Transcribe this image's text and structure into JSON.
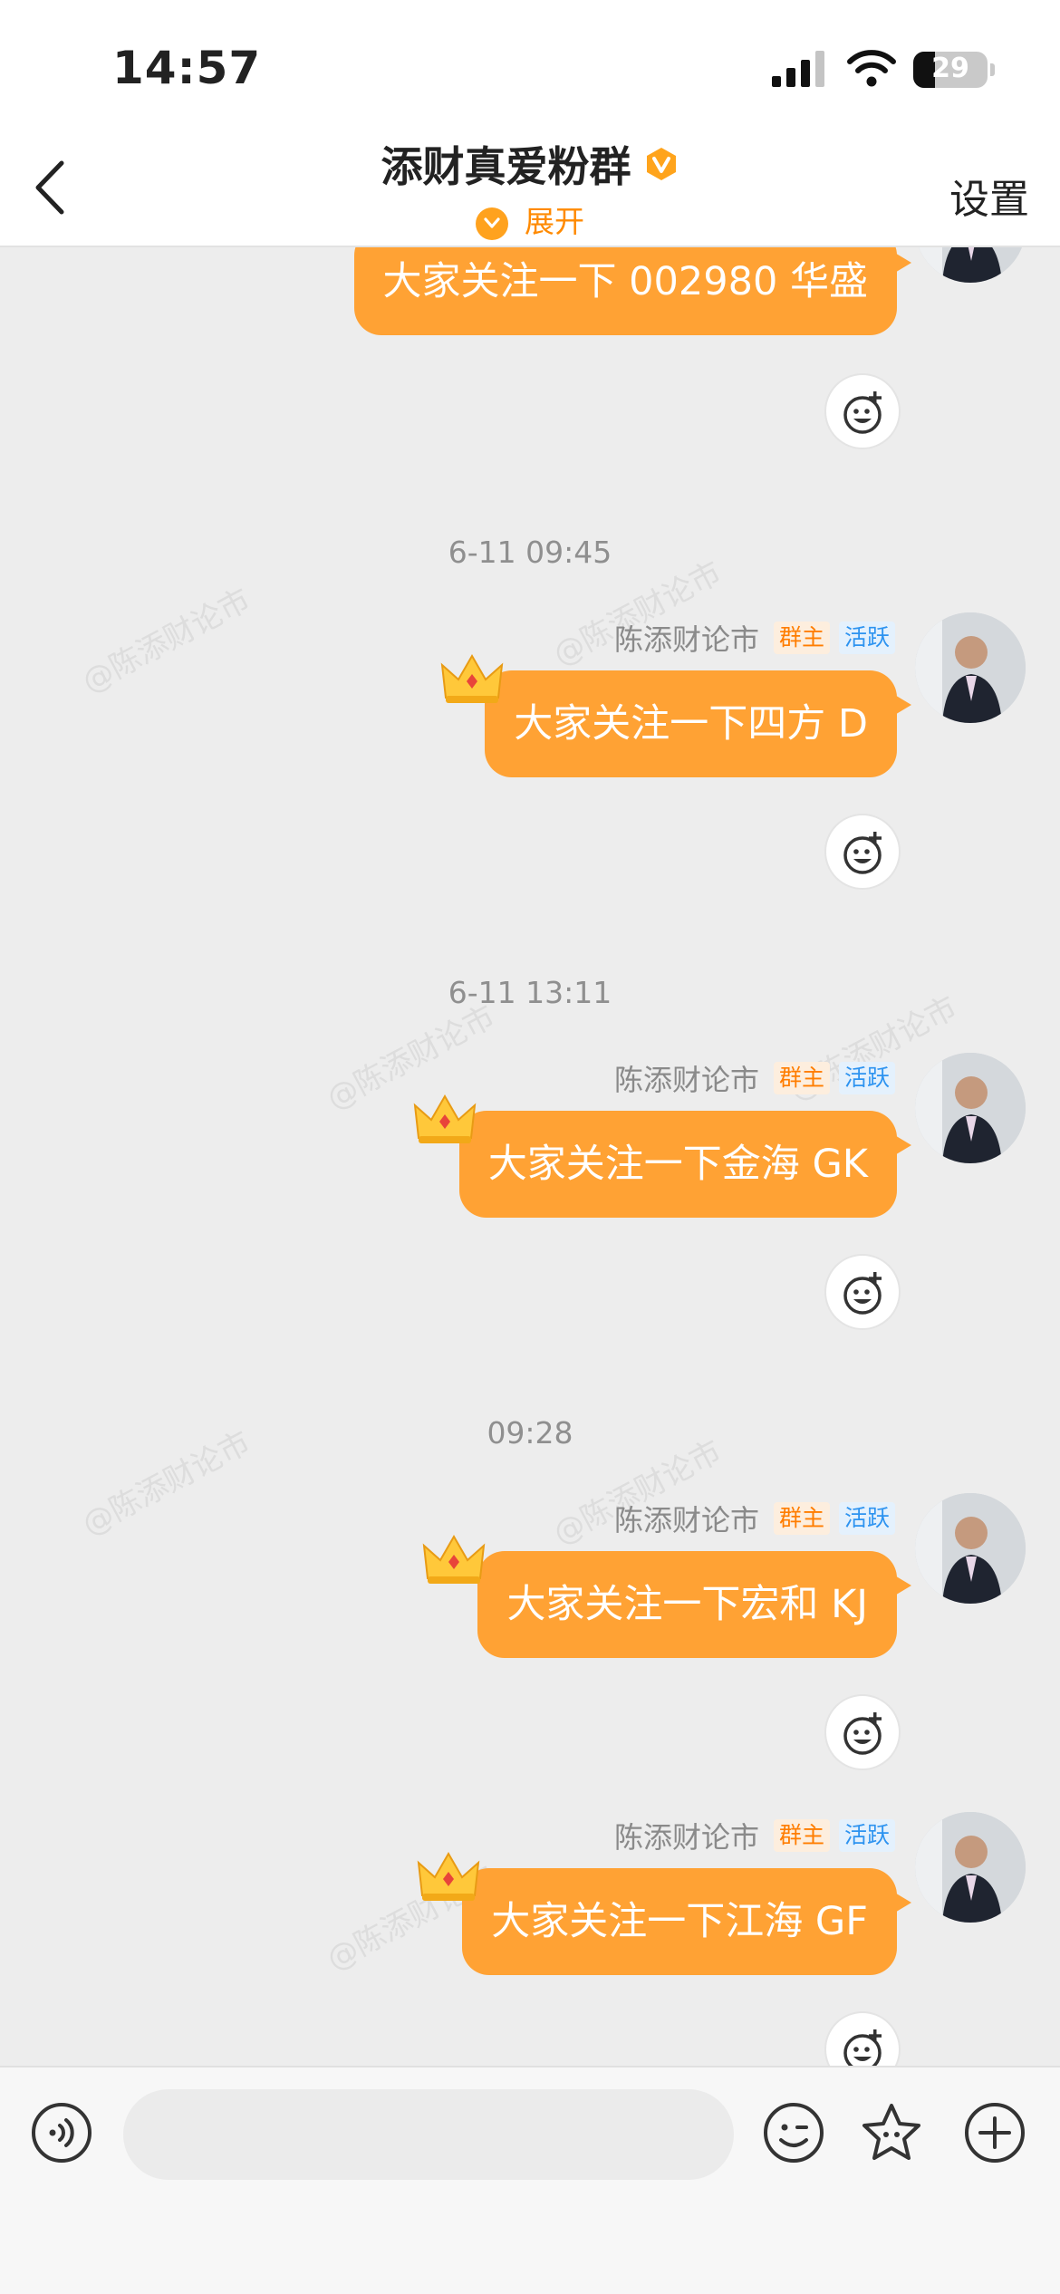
{
  "status_bar": {
    "time": "14:57",
    "battery": "29",
    "battery_level": 0.29
  },
  "header": {
    "back_label": "返回",
    "title": "添财真爱粉群",
    "expand_label": "展开",
    "settings_label": "设置"
  },
  "watermark_text": "@陈添财论市",
  "messages": [
    {
      "sender": "",
      "text": "大家关注一下 002980 华盛"
    },
    {
      "timestamp": "6-11 09:45",
      "sender": "陈添财论市",
      "owner_tag": "群主",
      "active_tag": "活跃",
      "text": "大家关注一下四方 D"
    },
    {
      "timestamp": "6-11 13:11",
      "sender": "陈添财论市",
      "owner_tag": "群主",
      "active_tag": "活跃",
      "text": "大家关注一下金海 GK"
    },
    {
      "timestamp": "09:28",
      "sender": "陈添财论市",
      "owner_tag": "群主",
      "active_tag": "活跃",
      "text": "大家关注一下宏和 KJ"
    },
    {
      "sender": "陈添财论市",
      "owner_tag": "群主",
      "active_tag": "活跃",
      "text": "大家关注一下江海 GF"
    }
  ],
  "input": {
    "placeholder": ""
  },
  "colors": {
    "accent": "#ffa234",
    "owner_tag": "#ff7d00",
    "active_tag": "#2d93f0",
    "background": "#ededed"
  }
}
